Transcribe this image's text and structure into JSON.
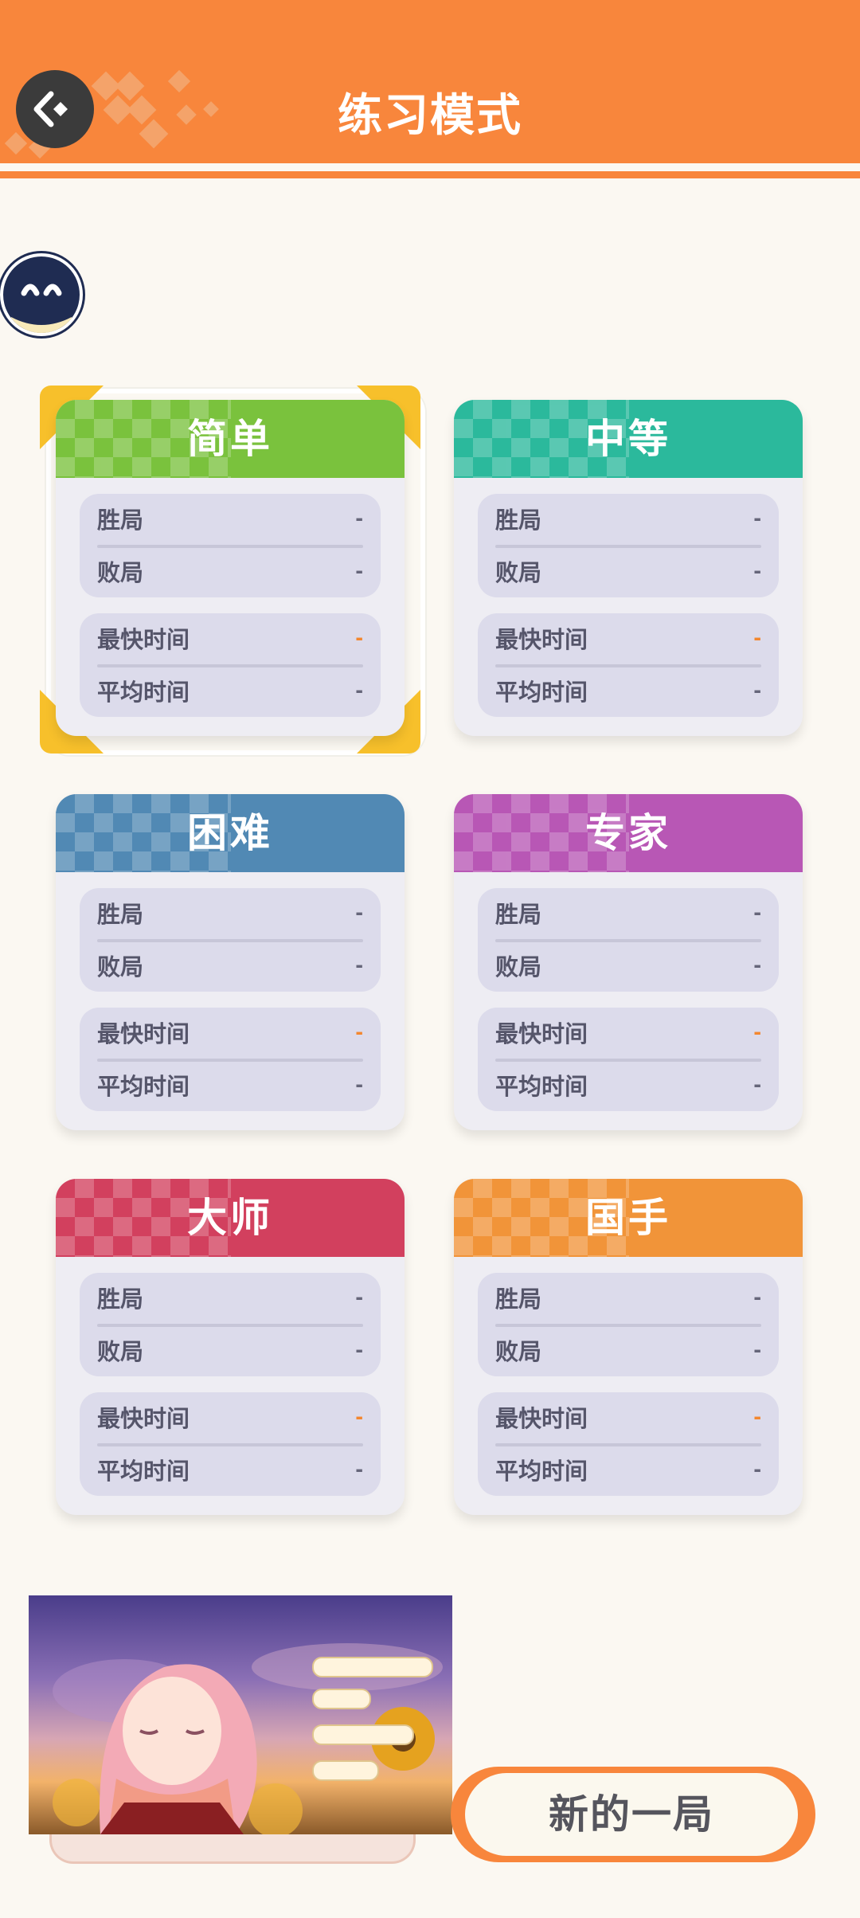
{
  "header": {
    "title": "练习模式",
    "back_icon": "back-arrow-icon"
  },
  "colors": {
    "accent": "#f8863c",
    "easy": "#7ac23d",
    "medium": "#2bb99c",
    "hard": "#5189b4",
    "expert": "#b857b5",
    "master": "#d2405e",
    "grandmaster": "#f19439"
  },
  "cards": [
    {
      "title": "简单",
      "win_label": "胜局",
      "win": "-",
      "loss_label": "败局",
      "loss": "-",
      "fastest_label": "最快时间",
      "fastest": "-",
      "avg_label": "平均时间",
      "avg": "-"
    },
    {
      "title": "中等",
      "win_label": "胜局",
      "win": "-",
      "loss_label": "败局",
      "loss": "-",
      "fastest_label": "最快时间",
      "fastest": "-",
      "avg_label": "平均时间",
      "avg": "-"
    },
    {
      "title": "困难",
      "win_label": "胜局",
      "win": "-",
      "loss_label": "败局",
      "loss": "-",
      "fastest_label": "最快时间",
      "fastest": "-",
      "avg_label": "平均时间",
      "avg": "-"
    },
    {
      "title": "专家",
      "win_label": "胜局",
      "win": "-",
      "loss_label": "败局",
      "loss": "-",
      "fastest_label": "最快时间",
      "fastest": "-",
      "avg_label": "平均时间",
      "avg": "-"
    },
    {
      "title": "大师",
      "win_label": "胜局",
      "win": "-",
      "loss_label": "败局",
      "loss": "-",
      "fastest_label": "最快时间",
      "fastest": "-",
      "avg_label": "平均时间",
      "avg": "-"
    },
    {
      "title": "国手",
      "win_label": "胜局",
      "win": "-",
      "loss_label": "败局",
      "loss": "-",
      "fastest_label": "最快时间",
      "fastest": "-",
      "avg_label": "平均时间",
      "avg": "-"
    }
  ],
  "selected_card": "简单",
  "new_game_label": "新的一局"
}
